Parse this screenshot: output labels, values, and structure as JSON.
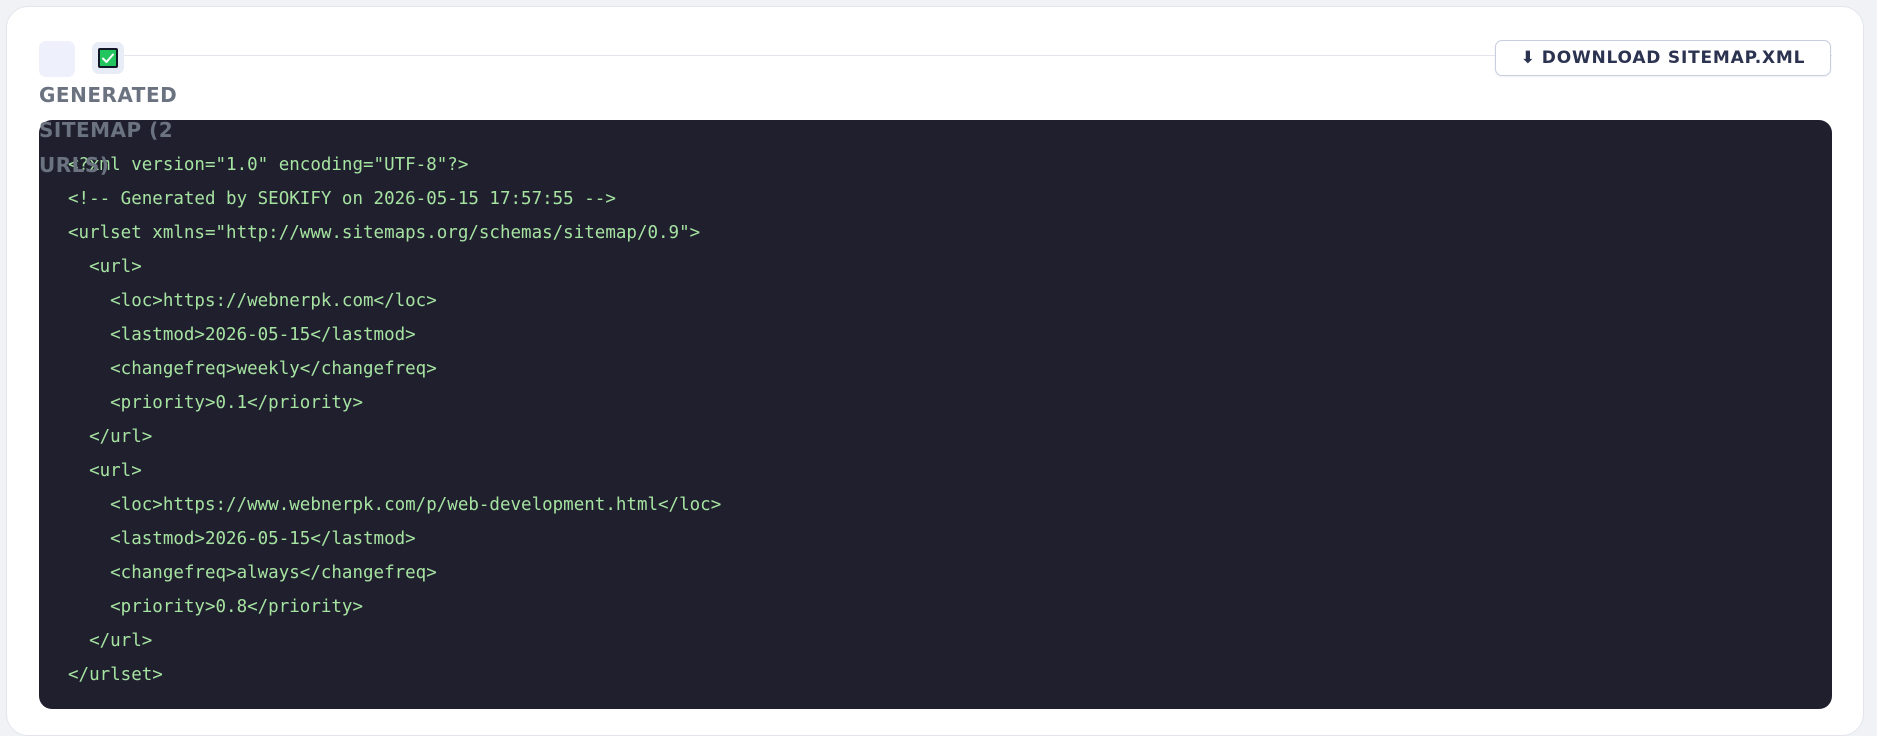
{
  "header": {
    "title": "GENERATED SITEMAP (2 URLS)",
    "download_label": "DOWNLOAD SITEMAP.XML",
    "download_icon": "⬇"
  },
  "icons": {
    "section_icon": "document-icon",
    "check_icon": "check-icon"
  },
  "colors": {
    "code_background": "#1f1f2e",
    "code_text": "#a6e3a1",
    "check_green": "#22c55e"
  },
  "code": {
    "lines": [
      "<?xml version=\"1.0\" encoding=\"UTF-8\"?>",
      "<!-- Generated by SEOKIFY on 2026-05-15 17:57:55 -->",
      "<urlset xmlns=\"http://www.sitemaps.org/schemas/sitemap/0.9\">",
      "  <url>",
      "    <loc>https://webnerpk.com</loc>",
      "    <lastmod>2026-05-15</lastmod>",
      "    <changefreq>weekly</changefreq>",
      "    <priority>0.1</priority>",
      "  </url>",
      "  <url>",
      "    <loc>https://www.webnerpk.com/p/web-development.html</loc>",
      "    <lastmod>2026-05-15</lastmod>",
      "    <changefreq>always</changefreq>",
      "    <priority>0.8</priority>",
      "  </url>",
      "</urlset>"
    ]
  }
}
